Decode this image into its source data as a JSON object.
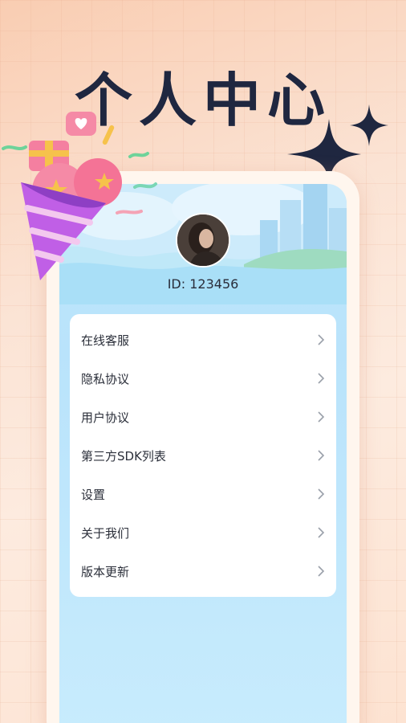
{
  "header": {
    "title": "个人中心"
  },
  "profile": {
    "id_text": "ID: 123456",
    "avatar_icon": "user-avatar-photo"
  },
  "menu": {
    "items": [
      {
        "label": "在线客服",
        "icon": "chevron-right-icon"
      },
      {
        "label": "隐私协议",
        "icon": "chevron-right-icon"
      },
      {
        "label": "用户协议",
        "icon": "chevron-right-icon"
      },
      {
        "label": "第三方SDK列表",
        "icon": "chevron-right-icon"
      },
      {
        "label": "设置",
        "icon": "chevron-right-icon"
      },
      {
        "label": "关于我们",
        "icon": "chevron-right-icon"
      },
      {
        "label": "版本更新",
        "icon": "chevron-right-icon"
      }
    ]
  },
  "colors": {
    "title": "#1f2740",
    "background": "#fbe3d4",
    "screen": "#bfe6fb",
    "card": "#ffffff",
    "chevron": "#9aa0aa"
  }
}
